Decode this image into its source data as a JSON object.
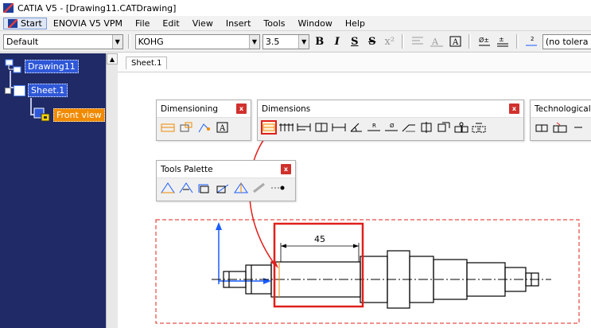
{
  "window": {
    "title": "CATIA V5 - [Drawing11.CATDrawing]"
  },
  "menubar": {
    "start": "Start",
    "items": [
      "ENOVIA V5 VPM",
      "File",
      "Edit",
      "View",
      "Insert",
      "Tools",
      "Window",
      "Help"
    ]
  },
  "toolbar": {
    "style_value": "Default",
    "font_value": "KOHG",
    "size_value": "3.5",
    "bold": "B",
    "italic": "I",
    "underline": "S",
    "strike": "S",
    "tolerance_value": "(no tolera"
  },
  "tree": {
    "root": "Drawing11",
    "sheet": "Sheet.1",
    "view": "Front view"
  },
  "sheet_tab": "Sheet.1",
  "palettes": {
    "dimensioning": {
      "title": "Dimensioning",
      "close": "x"
    },
    "dimensions": {
      "title": "Dimensions",
      "close": "x"
    },
    "technological": {
      "title": "Technological"
    },
    "tools_palette": {
      "title": "Tools Palette",
      "close": "x"
    }
  },
  "drawing": {
    "dimension_value": "45"
  },
  "colors": {
    "tree_bg": "#1f2a66",
    "tree_selected": "#2f58d8",
    "tree_active": "#f08a00",
    "highlight_red": "#e0201b",
    "axis_blue": "#1a5cff"
  }
}
